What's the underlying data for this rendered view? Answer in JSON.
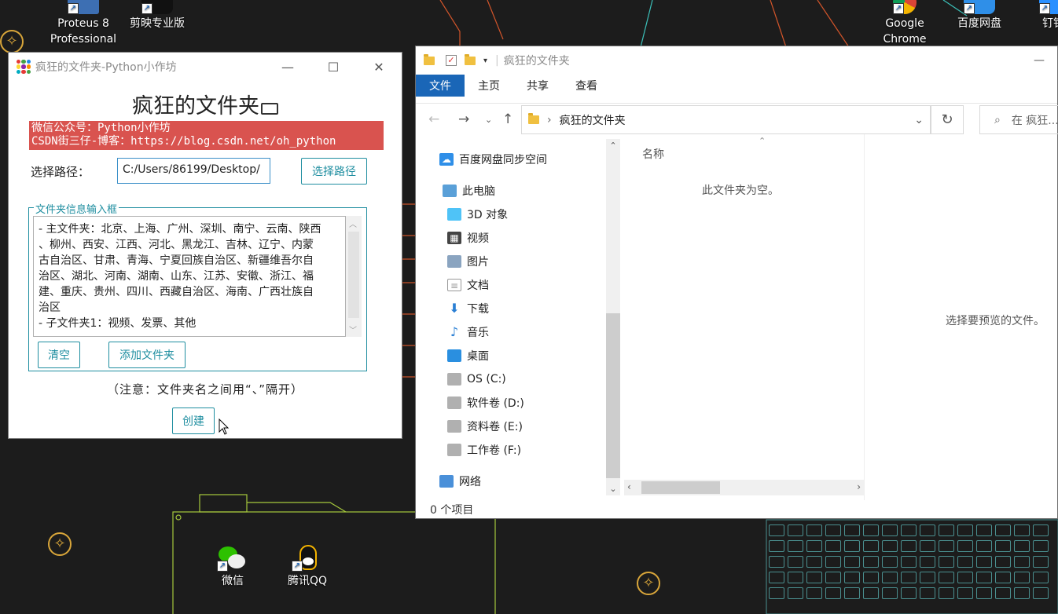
{
  "desktop": {
    "icons": [
      {
        "label": "Proteus 8 Professional",
        "icon": "proteus-icon"
      },
      {
        "label": "剪映专业版",
        "icon": "jianying-icon"
      },
      {
        "label": "Google Chrome",
        "icon": "chrome-icon"
      },
      {
        "label": "百度网盘",
        "icon": "baidu-netdisk-icon"
      },
      {
        "label": "钉钉",
        "icon": "dingtalk-icon"
      },
      {
        "label": "微信",
        "icon": "wechat-icon"
      },
      {
        "label": "腾讯QQ",
        "icon": "qq-icon"
      }
    ]
  },
  "app": {
    "window_title": "疯狂的文件夹-Python小作坊",
    "heading": "疯狂的文件夹",
    "banner_line1": "微信公众号：Python小作坊",
    "banner_line2": "CSDN街三仔-博客：https://blog.csdn.net/oh_python",
    "path_label": "选择路径：",
    "path_value": "C:/Users/86199/Desktop/",
    "choose_path_button": "选择路径",
    "group_label": "文件夹信息输入框",
    "text_lines": [
      "- 主文件夹：北京、上海、广州、深圳、南宁、云南、陕西",
      "、柳州、西安、江西、河北、黑龙江、吉林、辽宁、内蒙",
      "古自治区、甘肃、青海、宁夏回族自治区、新疆维吾尔自",
      "治区、湖北、河南、湖南、山东、江苏、安徽、浙江、福",
      "建、重庆、贵州、四川、西藏自治区、海南、广西壮族自",
      "治区",
      "- 子文件夹1：视频、发票、其他"
    ],
    "clear_button": "清空",
    "add_folder_button": "添加文件夹",
    "note": "（注意：文件夹名之间用“、”隔开）",
    "create_button": "创建"
  },
  "explorer": {
    "window_title": "疯狂的文件夹",
    "ribbon_tabs": [
      "文件",
      "主页",
      "共享",
      "查看"
    ],
    "address": "疯狂的文件夹",
    "search_placeholder": "在 疯狂...",
    "nav_items": [
      {
        "label": "百度网盘同步空间",
        "icon": "baidu-sync-icon"
      },
      {
        "label": "此电脑",
        "icon": "this-pc-icon"
      },
      {
        "label": "3D 对象",
        "icon": "3d-objects-icon"
      },
      {
        "label": "视频",
        "icon": "videos-icon"
      },
      {
        "label": "图片",
        "icon": "pictures-icon"
      },
      {
        "label": "文档",
        "icon": "documents-icon"
      },
      {
        "label": "下载",
        "icon": "downloads-icon"
      },
      {
        "label": "音乐",
        "icon": "music-icon"
      },
      {
        "label": "桌面",
        "icon": "desktop-icon"
      },
      {
        "label": "OS (C:)",
        "icon": "drive-icon"
      },
      {
        "label": "软件卷 (D:)",
        "icon": "drive-icon"
      },
      {
        "label": "资料卷 (E:)",
        "icon": "drive-icon"
      },
      {
        "label": "工作卷 (F:)",
        "icon": "drive-icon"
      },
      {
        "label": "网络",
        "icon": "network-icon"
      }
    ],
    "column_name": "名称",
    "empty_message": "此文件夹为空。",
    "preview_message": "选择要预览的文件。",
    "status": "0 个项目"
  }
}
